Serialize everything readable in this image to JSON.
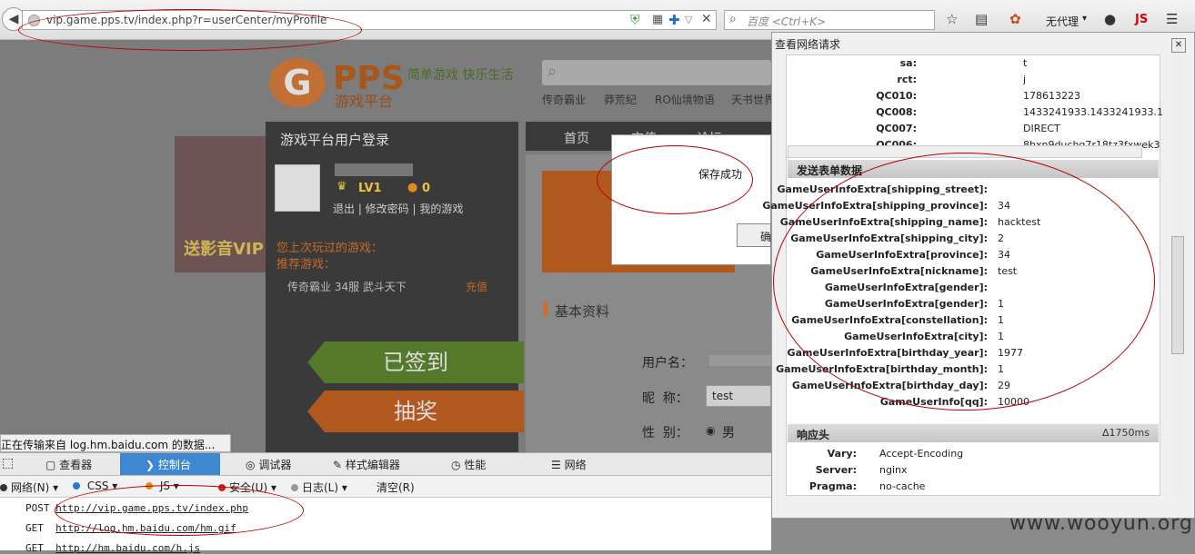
{
  "browser": {
    "url": "vip.game.pps.tv/index.php?r=userCenter/myProfile",
    "search_placeholder": "百度 <Ctrl+K>",
    "proxy_label": "无代理",
    "js_label": "JS"
  },
  "page": {
    "logo_letter": "G",
    "logo_text": "PPS",
    "logo_sub": "游戏平台",
    "slogan": "简单游戏 快乐生活",
    "game_links": [
      "传奇霸业",
      "莽荒纪",
      "RO仙境物语",
      "天书世界"
    ],
    "vip_banner": "送影音VIP",
    "login_title": "游戏平台用户登录",
    "level": "LV1",
    "coins": "0",
    "user_links": "退出 | 修改密码 | 我的游戏",
    "last_played": "您上次玩过的游戏：",
    "recommend": "推荐游戏：",
    "game_row": "传奇霸业 34服 武斗天下",
    "charge": "充值",
    "signed": "已签到",
    "lottery": "抽奖",
    "nav": [
      "首页",
      "充值",
      "论坛"
    ],
    "basic_info": "基本资料",
    "username_label": "用户名：",
    "nickname_label": "昵  称：",
    "nickname_value": "test",
    "gender_label": "性  别：",
    "gender_value": "男",
    "dialog_text": "保存成功",
    "dialog_btn": "确",
    "status_text": "正在传输来自 log.hm.baidu.com 的数据..."
  },
  "devtools": {
    "tabs": [
      "查看器",
      "控制台",
      "调试器",
      "样式编辑器",
      "性能",
      "网络"
    ],
    "filters": [
      "网络(N)",
      "CSS",
      "JS",
      "安全(U)",
      "日志(L)",
      "清空(R)"
    ],
    "log": [
      {
        "method": "POST",
        "url": "http://vip.game.pps.tv/index.php"
      },
      {
        "method": "GET",
        "url": "http://log.hm.baidu.com/hm.gif"
      },
      {
        "method": "GET",
        "url": "http://hm.baidu.com/h.js"
      }
    ]
  },
  "netpanel": {
    "title": "查看网络请求",
    "cookies": [
      {
        "k": "sa:",
        "v": "t"
      },
      {
        "k": "rct:",
        "v": "j"
      },
      {
        "k": "QC010:",
        "v": "178613223"
      },
      {
        "k": "QC008:",
        "v": "1433241933.1433241933.1"
      },
      {
        "k": "QC007:",
        "v": "DIRECT"
      },
      {
        "k": "QC006:",
        "v": "8hxn9duchg7r18tz3fxwek3"
      }
    ],
    "form_title": "发送表单数据",
    "form": [
      {
        "k": "GameUserInfoExtra[shipping_street]:",
        "v": ""
      },
      {
        "k": "GameUserInfoExtra[shipping_province]:",
        "v": "34"
      },
      {
        "k": "GameUserInfoExtra[shipping_name]:",
        "v": "hacktest"
      },
      {
        "k": "GameUserInfoExtra[shipping_city]:",
        "v": "2"
      },
      {
        "k": "GameUserInfoExtra[province]:",
        "v": "34"
      },
      {
        "k": "GameUserInfoExtra[nickname]:",
        "v": "test"
      },
      {
        "k": "GameUserInfoExtra[gender]:",
        "v": ""
      },
      {
        "k": "GameUserInfoExtra[gender]:",
        "v": "1"
      },
      {
        "k": "GameUserInfoExtra[constellation]:",
        "v": "1"
      },
      {
        "k": "GameUserInfoExtra[city]:",
        "v": "1"
      },
      {
        "k": "GameUserInfoExtra[birthday_year]:",
        "v": "1977"
      },
      {
        "k": "GameUserInfoExtra[birthday_month]:",
        "v": "1"
      },
      {
        "k": "GameUserInfoExtra[birthday_day]:",
        "v": "29"
      },
      {
        "k": "GameUserInfo[qq]:",
        "v": "10000"
      }
    ],
    "response_title": "响应头",
    "response_time": "Δ1750ms",
    "response": [
      {
        "k": "Vary:",
        "v": "Accept-Encoding"
      },
      {
        "k": "Server:",
        "v": "nginx"
      },
      {
        "k": "Pragma:",
        "v": "no-cache"
      }
    ]
  },
  "watermark": "www.wooyun.org"
}
